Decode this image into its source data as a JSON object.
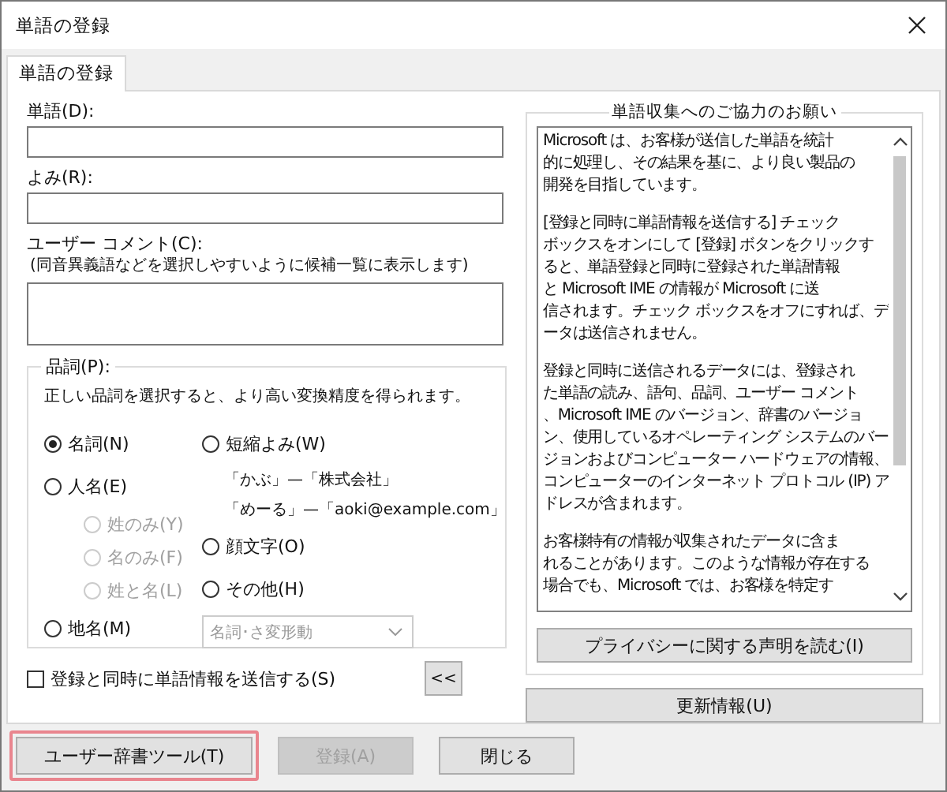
{
  "window": {
    "title": "単語の登録"
  },
  "tabs": [
    {
      "label": "単語の登録",
      "selected": true
    }
  ],
  "word": {
    "label": "単語(D):"
  },
  "reading": {
    "label": "よみ(R):"
  },
  "comment": {
    "label": "ユーザー コメント(C):",
    "hint": "(同音異義語などを選択しやすいように候補一覧に表示します)"
  },
  "part_of_speech": {
    "title": "品詞(P):",
    "description": "正しい品詞を選択すると、より高い変換精度を得られます。",
    "left": [
      {
        "kind": "radio",
        "label": "名詞(N)",
        "selected": true,
        "disabled": false
      },
      {
        "kind": "radio",
        "label": "人名(E)",
        "selected": false,
        "disabled": false
      },
      {
        "kind": "subradio",
        "label": "姓のみ(Y)",
        "selected": false,
        "disabled": true
      },
      {
        "kind": "subradio",
        "label": "名のみ(F)",
        "selected": false,
        "disabled": true
      },
      {
        "kind": "subradio",
        "label": "姓と名(L)",
        "selected": false,
        "disabled": true
      },
      {
        "kind": "radio",
        "label": "地名(M)",
        "selected": false,
        "disabled": false
      }
    ],
    "right": [
      {
        "kind": "radio",
        "label": "短縮よみ(W)",
        "selected": false,
        "disabled": false
      },
      {
        "kind": "example",
        "label": "「かぶ」—「株式会社」"
      },
      {
        "kind": "example",
        "label": "「めーる」—「aoki@example.com」"
      },
      {
        "kind": "radio",
        "label": "顔文字(O)",
        "selected": false,
        "disabled": false
      },
      {
        "kind": "radio",
        "label": "その他(H)",
        "selected": false,
        "disabled": false
      },
      {
        "kind": "dropdown",
        "label": "名詞･さ変形動",
        "disabled": true
      }
    ]
  },
  "send_checkbox": {
    "label": "登録と同時に単語情報を送信する(S)",
    "checked": false
  },
  "collapse_button": "<<",
  "info": {
    "title": "単語収集へのご協力のお願い",
    "paragraphs": [
      [
        "Microsoft は、お客様が送信した単語を統計",
        "的に処理し、その結果を基に、より良い製品の",
        "開発を目指しています。"
      ],
      [
        "[登録と同時に単語情報を送信する] チェック",
        "ボックスをオンにして [登録] ボタンをクリックす",
        "ると、単語登録と同時に登録された単語情報",
        "と Microsoft IME の情報が Microsoft に送",
        "信されます。チェック ボックスをオフにすれば、デ",
        "ータは送信されません。"
      ],
      [
        "登録と同時に送信されるデータには、登録され",
        "た単語の読み、語句、品詞、ユーザー コメント",
        "、Microsoft IME のバージョン、辞書のバージョ",
        "ン、使用しているオペレーティング システムのバー",
        "ジョンおよびコンピューター ハードウェアの情報、",
        "コンピューターのインターネット プロトコル (IP) ア",
        "ドレスが含まれます。"
      ],
      [
        "お客様特有の情報が収集されたデータに含ま",
        "れることがあります。このような情報が存在する",
        "場合でも、Microsoft では、お客様を特定す"
      ]
    ],
    "privacy_button": "プライバシーに関する声明を読む(I)"
  },
  "update_button": "更新情報(U)",
  "buttons": [
    {
      "label": "ユーザー辞書ツール(T)",
      "disabled": false,
      "highlighted": true
    },
    {
      "label": "登録(A)",
      "disabled": true
    },
    {
      "label": "閉じる",
      "disabled": false
    }
  ]
}
